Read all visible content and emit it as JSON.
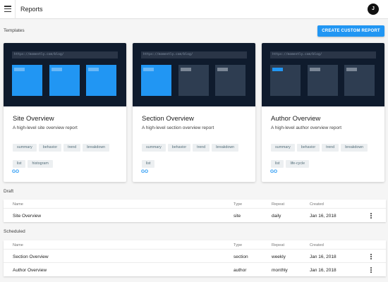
{
  "header": {
    "title": "Reports",
    "avatar_initial": "J"
  },
  "templates": {
    "section_label": "Templates",
    "create_button": "CREATE CUSTOM REPORT",
    "cards": [
      {
        "url": "https://momently.com/blog/",
        "title": "Site Overview",
        "description": "A high-level site overview report",
        "tags": [
          "summary",
          "behavior",
          "trend",
          "breakdown",
          "list",
          "histogram"
        ],
        "action": "GO"
      },
      {
        "url": "https://momently.com/blog/",
        "title": "Section Overview",
        "description": "A high-level section overview report",
        "tags": [
          "summary",
          "behavior",
          "trend",
          "breakdown",
          "list"
        ],
        "action": "GO"
      },
      {
        "url": "https://momently.com/blog/",
        "title": "Author Overview",
        "description": "A high-level author overview report",
        "tags": [
          "summary",
          "behavior",
          "trend",
          "breakdown",
          "list",
          "life-cycle"
        ],
        "action": "GO"
      }
    ]
  },
  "draft": {
    "section_label": "Draft",
    "columns": [
      "Name",
      "Type",
      "Repeat",
      "Created"
    ],
    "rows": [
      {
        "name": "Site Overview",
        "type": "site",
        "repeat": "daily",
        "created": "Jan 16, 2018"
      }
    ]
  },
  "scheduled": {
    "section_label": "Scheduled",
    "columns": [
      "Name",
      "Type",
      "Repeat",
      "Created"
    ],
    "rows": [
      {
        "name": "Section Overview",
        "type": "section",
        "repeat": "weekly",
        "created": "Jan 16, 2018"
      },
      {
        "name": "Author Overview",
        "type": "author",
        "repeat": "monthly",
        "created": "Jan 16, 2018"
      }
    ]
  },
  "colors": {
    "accent": "#2196f3",
    "preview_bg": "#0f1b2d",
    "panel": "#2e3d51"
  }
}
